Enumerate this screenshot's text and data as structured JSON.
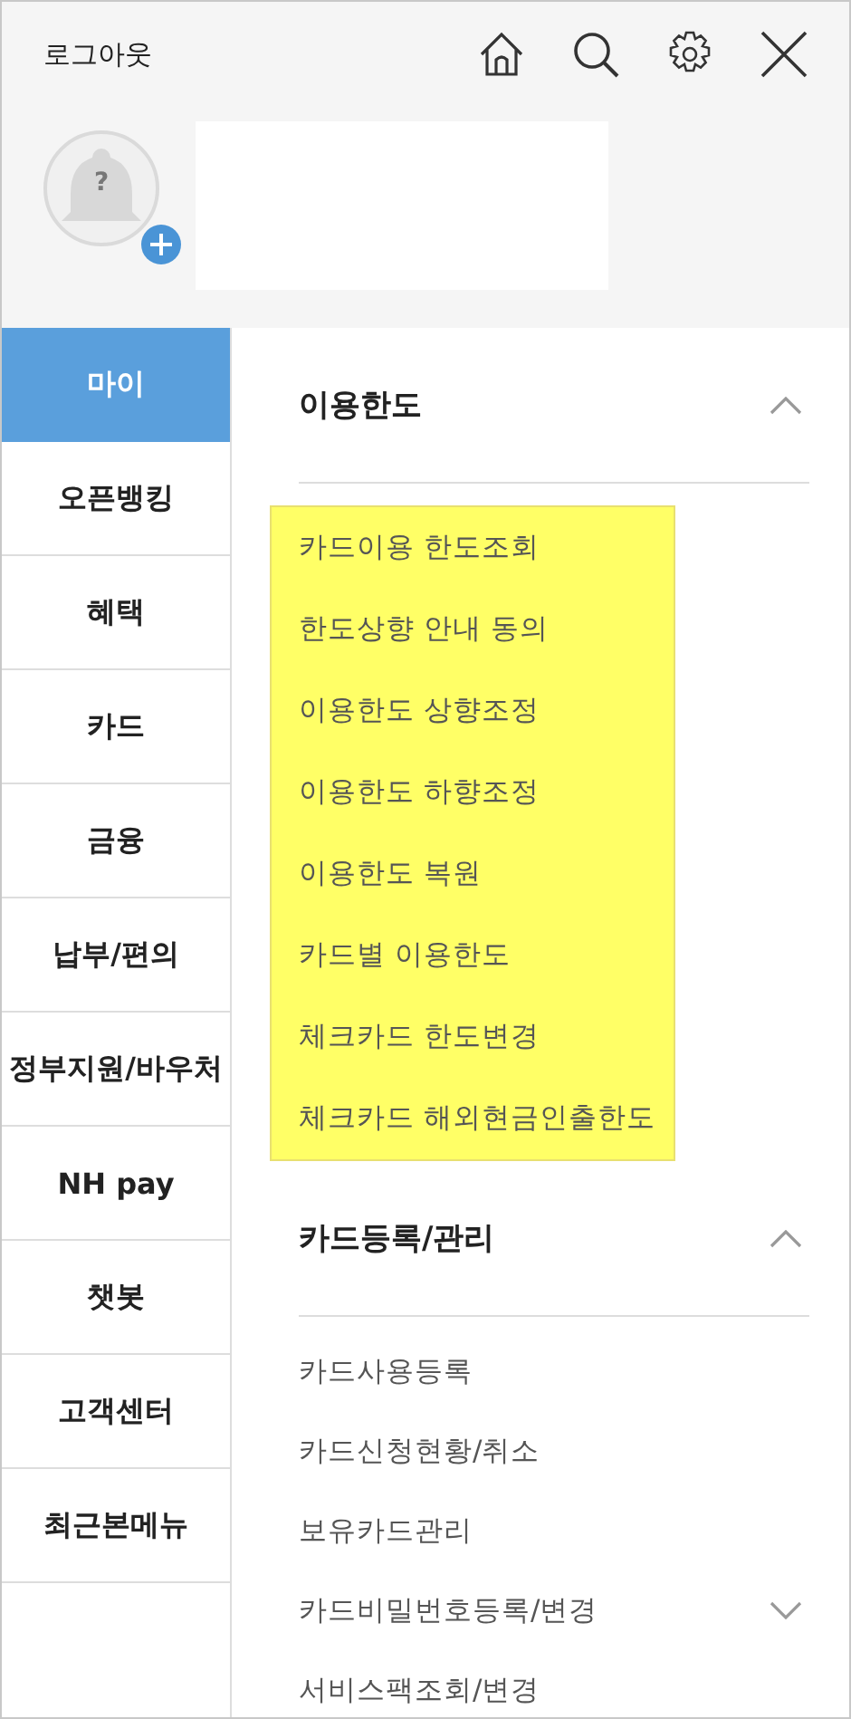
{
  "header": {
    "logout": "로그아웃",
    "avatar": {
      "mark": "?"
    }
  },
  "sidebar": {
    "items": [
      {
        "label": "마이",
        "selected": true
      },
      {
        "label": "오픈뱅킹",
        "selected": false
      },
      {
        "label": "혜택",
        "selected": false
      },
      {
        "label": "카드",
        "selected": false
      },
      {
        "label": "금융",
        "selected": false
      },
      {
        "label": "납부/편의",
        "selected": false
      },
      {
        "label": "정부지원/바우처",
        "selected": false
      },
      {
        "label": "NH pay",
        "selected": false
      },
      {
        "label": "챗봇",
        "selected": false
      },
      {
        "label": "고객센터",
        "selected": false
      },
      {
        "label": "최근본메뉴",
        "selected": false
      }
    ]
  },
  "sections": [
    {
      "title": "이용한도",
      "expanded": true,
      "highlighted": true,
      "items": [
        {
          "label": "카드이용 한도조회",
          "kind": "link"
        },
        {
          "label": "한도상향 안내 동의",
          "kind": "link"
        },
        {
          "label": "이용한도 상향조정",
          "kind": "link"
        },
        {
          "label": "이용한도 하향조정",
          "kind": "link"
        },
        {
          "label": "이용한도 복원",
          "kind": "link"
        },
        {
          "label": "카드별 이용한도",
          "kind": "link"
        },
        {
          "label": "체크카드 한도변경",
          "kind": "link"
        },
        {
          "label": "체크카드 해외현금인출한도",
          "kind": "link"
        }
      ]
    },
    {
      "title": "카드등록/관리",
      "expanded": true,
      "highlighted": false,
      "items": [
        {
          "label": "카드사용등록",
          "kind": "link"
        },
        {
          "label": "카드신청현황/취소",
          "kind": "link"
        },
        {
          "label": "보유카드관리",
          "kind": "link"
        },
        {
          "label": "카드비밀번호등록/변경",
          "kind": "submenu",
          "expanded": false
        },
        {
          "label": "서비스팩조회/변경",
          "kind": "link"
        }
      ]
    }
  ]
}
